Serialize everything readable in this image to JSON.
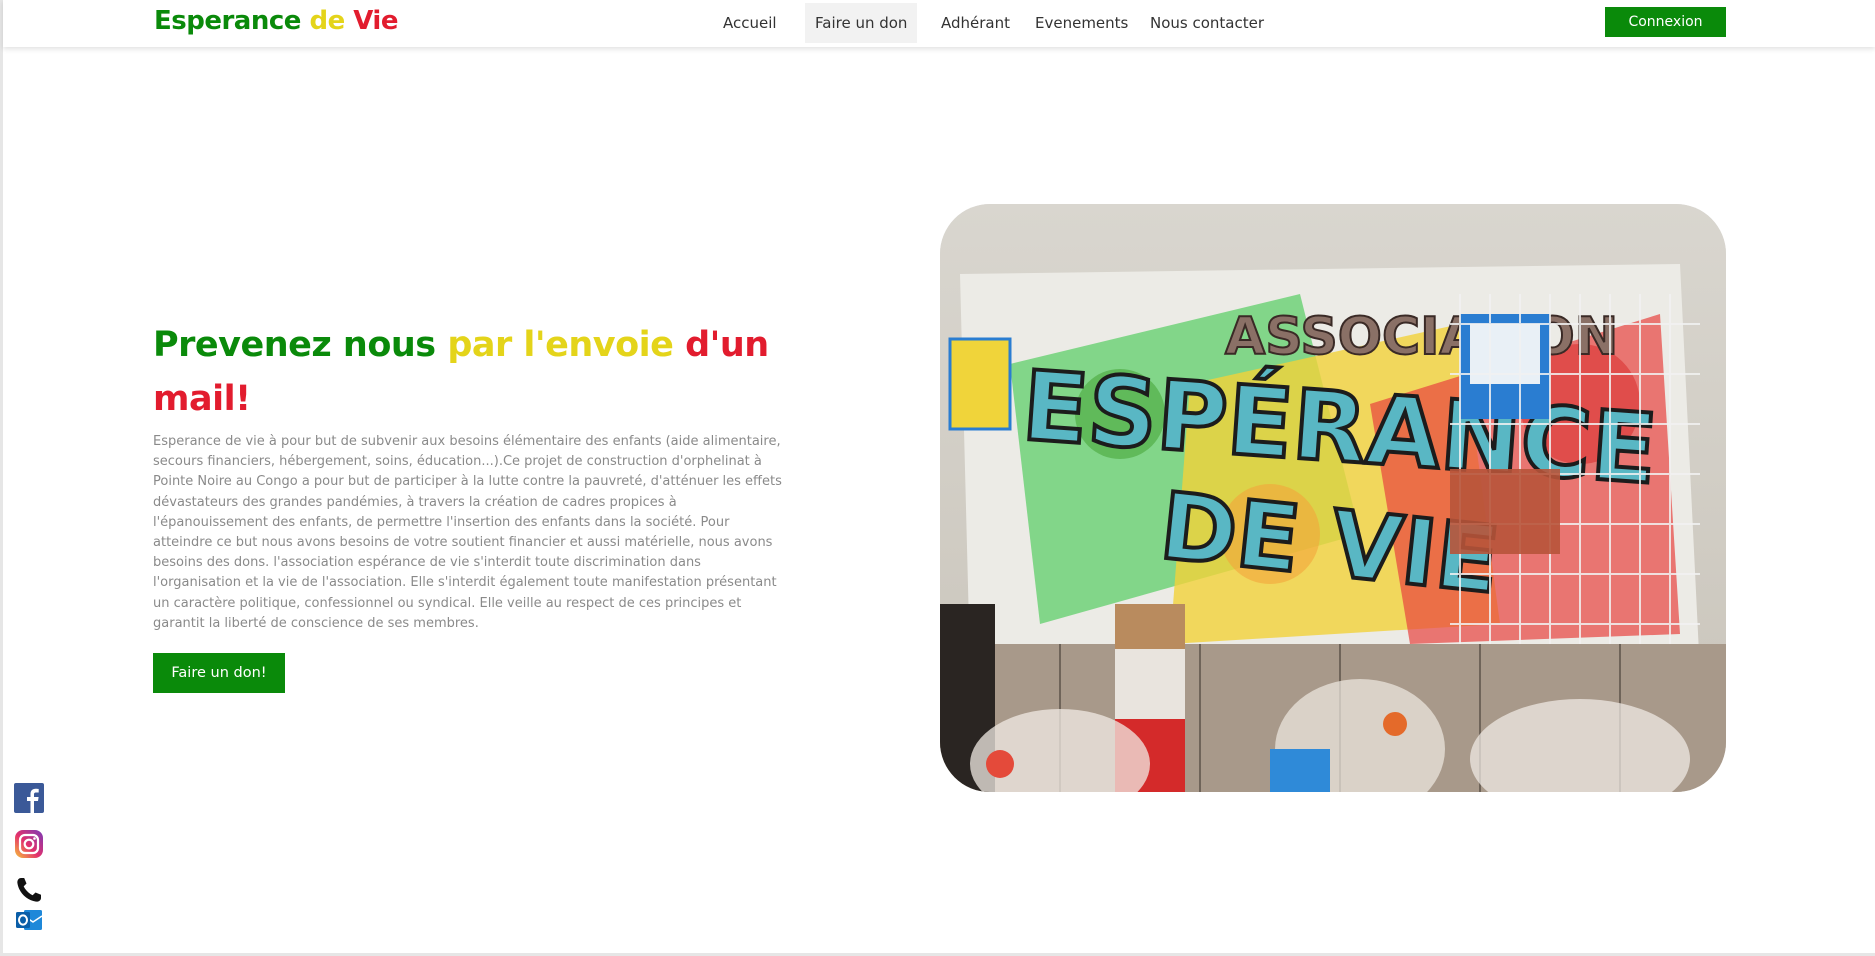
{
  "header": {
    "logo": {
      "part1": "Esperance ",
      "part2": "de ",
      "part3": "Vie"
    },
    "nav": [
      {
        "label": "Accueil"
      },
      {
        "label": "Faire un don",
        "active": true
      },
      {
        "label": "Adhérant"
      },
      {
        "label": "Evenements"
      },
      {
        "label": "Nous contacter"
      }
    ],
    "connexion_label": "Connexion"
  },
  "hero": {
    "headline": {
      "green": "Prevenez nous ",
      "yellow": "par l'envoie ",
      "red": "d'un mail!"
    },
    "description": "Esperance de vie à pour but de subvenir aux besoins élémentaire des enfants (aide alimentaire, secours financiers, hébergement, soins, éducation...).Ce projet de construction d'orphelinat à Pointe Noire au Congo a pour but de participer à la lutte contre la pauvreté, d'atténuer les effets dévastateurs des grandes pandémies, à travers la création de cadres propices à l'épanouissement des enfants, de permettre l'insertion des enfants dans la société. Pour atteindre ce but nous avons besoins de votre soutient financier et aussi matérielle, nous avons besoins des dons. l'association espérance de vie s'interdit toute discrimination dans l'organisation et la vie de l'association. Elle s'interdit également toute manifestation présentant un caractère politique, confessionnel ou syndical. Elle veille au respect de ces principes et garantit la liberté de conscience de ses membres.",
    "button_label": "Faire un don!"
  },
  "photo": {
    "banner_text_line1": "ASSOCIATION",
    "banner_text_line2": "ESPÉRANCE",
    "banner_text_line3": "DE VIE"
  },
  "social": [
    "facebook-icon",
    "instagram-icon",
    "phone-icon",
    "outlook-icon"
  ],
  "colors": {
    "green": "#0a8a0a",
    "yellow": "#e4d41a",
    "red": "#e21c2e"
  }
}
